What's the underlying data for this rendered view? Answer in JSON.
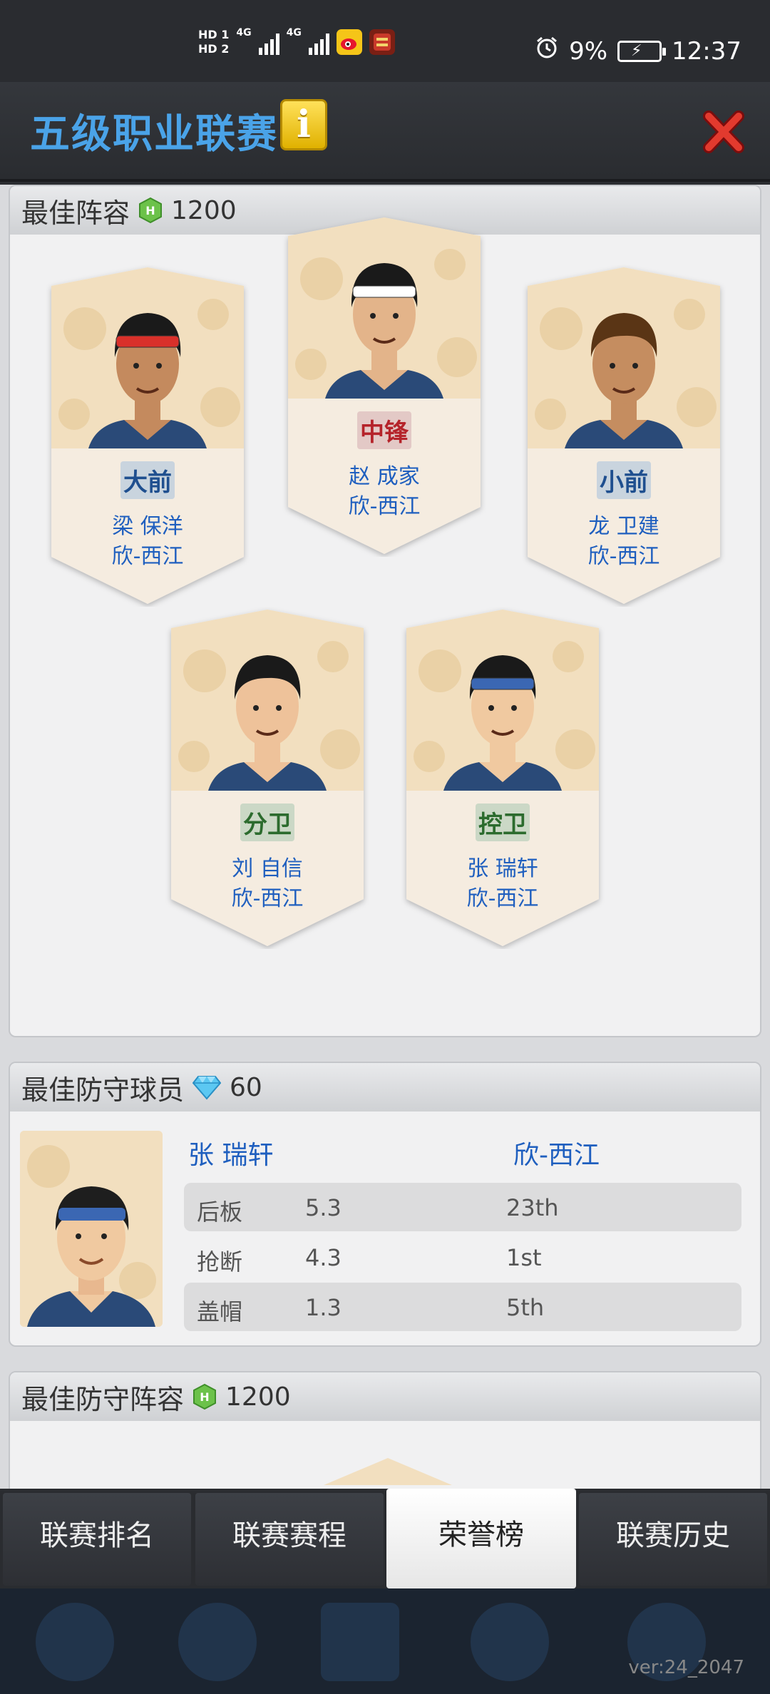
{
  "statusbar": {
    "hd1": "HD 1",
    "hd2": "HD 2",
    "net1": "4G",
    "net2": "4G",
    "battery": "9%",
    "time": "12:37"
  },
  "header": {
    "title": "五级职业联赛",
    "info_glyph": "i",
    "title_color": "#4aa3e8",
    "close_icon": "close-icon"
  },
  "best_lineup": {
    "title": "最佳阵容",
    "reward": "1200",
    "players": [
      {
        "position": "大前",
        "name": "梁 保洋",
        "team": "欣-西江",
        "pos_color": "#1f4f8f"
      },
      {
        "position": "中锋",
        "name": "赵 成家",
        "team": "欣-西江",
        "pos_color": "#b5232a"
      },
      {
        "position": "小前",
        "name": "龙 卫建",
        "team": "欣-西江",
        "pos_color": "#1f4f8f"
      },
      {
        "position": "分卫",
        "name": "刘 自信",
        "team": "欣-西江",
        "pos_color": "#2c6b2e"
      },
      {
        "position": "控卫",
        "name": "张 瑞轩",
        "team": "欣-西江",
        "pos_color": "#2c6b2e"
      }
    ]
  },
  "best_defender": {
    "title": "最佳防守球员",
    "reward": "60",
    "name": "张 瑞轩",
    "team": "欣-西江",
    "stats": [
      {
        "label": "后板",
        "value": "5.3",
        "rank": "23th"
      },
      {
        "label": "抢断",
        "value": "4.3",
        "rank": "1st"
      },
      {
        "label": "盖帽",
        "value": "1.3",
        "rank": "5th"
      }
    ]
  },
  "best_defense_lineup": {
    "title": "最佳防守阵容",
    "reward": "1200"
  },
  "tabs": [
    {
      "label": "联赛排名",
      "active": false
    },
    {
      "label": "联赛赛程",
      "active": false
    },
    {
      "label": "荣誉榜",
      "active": true
    },
    {
      "label": "联赛历史",
      "active": false
    }
  ],
  "version": "ver:24_2047"
}
